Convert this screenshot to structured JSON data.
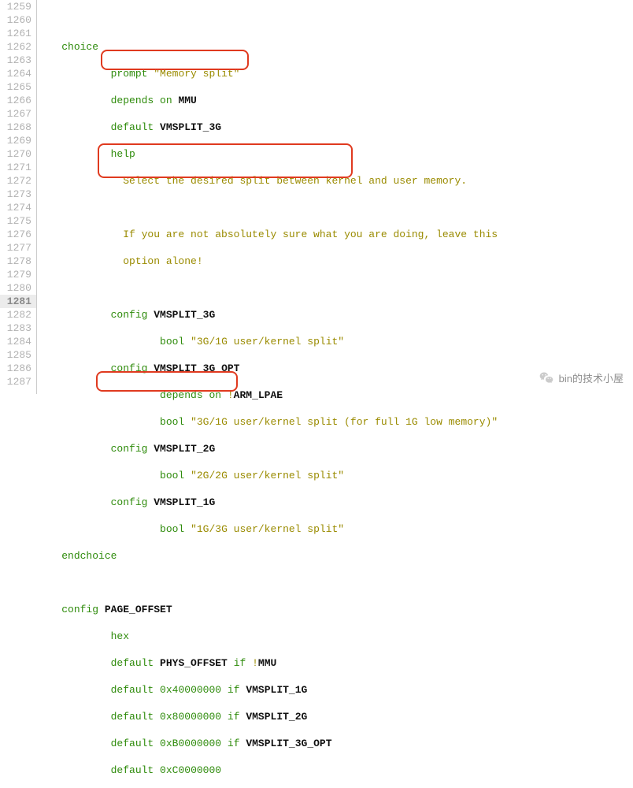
{
  "line_numbers": [
    "1259",
    "1260",
    "1261",
    "1262",
    "1263",
    "1264",
    "1265",
    "1266",
    "1267",
    "1268",
    "1269",
    "1270",
    "1271",
    "1272",
    "1273",
    "1274",
    "1275",
    "1276",
    "1277",
    "1278",
    "1279",
    "1280",
    "1281",
    "1282",
    "1283",
    "1284",
    "1285",
    "1286",
    "1287"
  ],
  "current_line_index": 22,
  "code": {
    "l1260_choice": "choice",
    "l1261_prompt": "prompt",
    "l1261_str": "\"Memory split\"",
    "l1262_depends": "depends on",
    "l1262_mmu": "MMU",
    "l1263_default": "default",
    "l1263_val": "VMSPLIT_3G",
    "l1264_help": "help",
    "l1265_text": "Select the desired split between kernel and user memory.",
    "l1267_text": "If you are not absolutely sure what you are doing, leave this",
    "l1268_text": "option alone!",
    "l1270_config": "config",
    "l1270_name": "VMSPLIT_3G",
    "l1271_bool": "bool",
    "l1271_str": "\"3G/1G user/kernel split\"",
    "l1272_config": "config",
    "l1272_name": "VMSPLIT_3G_OPT",
    "l1273_depends": "depends on",
    "l1273_bang": "!",
    "l1273_arm": "ARM_LPAE",
    "l1274_bool": "bool",
    "l1274_str": "\"3G/1G user/kernel split (for full 1G low memory)\"",
    "l1275_config": "config",
    "l1275_name": "VMSPLIT_2G",
    "l1276_bool": "bool",
    "l1276_str": "\"2G/2G user/kernel split\"",
    "l1277_config": "config",
    "l1277_name": "VMSPLIT_1G",
    "l1278_bool": "bool",
    "l1278_str": "\"1G/3G user/kernel split\"",
    "l1279_endchoice": "endchoice",
    "l1281_config": "config",
    "l1281_name": "PAGE_OFFSET",
    "l1282_hex": "hex",
    "l1283_default": "default",
    "l1283_phys": "PHYS_OFFSET",
    "l1283_if": "if",
    "l1283_bang": "!",
    "l1283_mmu": "MMU",
    "l1284_default": "default",
    "l1284_hex0": "0",
    "l1284_hexx": "x40000000",
    "l1284_if": "if",
    "l1284_cond": "VMSPLIT_1G",
    "l1285_default": "default",
    "l1285_hex0": "0",
    "l1285_hexx": "x80000000",
    "l1285_if": "if",
    "l1285_cond": "VMSPLIT_2G",
    "l1286_default": "default",
    "l1286_hex0": "0",
    "l1286_hexx": "xB0000000",
    "l1286_if": "if",
    "l1286_cond": "VMSPLIT_3G_OPT",
    "l1287_default": "default",
    "l1287_hex0": "0",
    "l1287_hexx": "xC0000000"
  },
  "watermark_text": "bin的技术小屋"
}
